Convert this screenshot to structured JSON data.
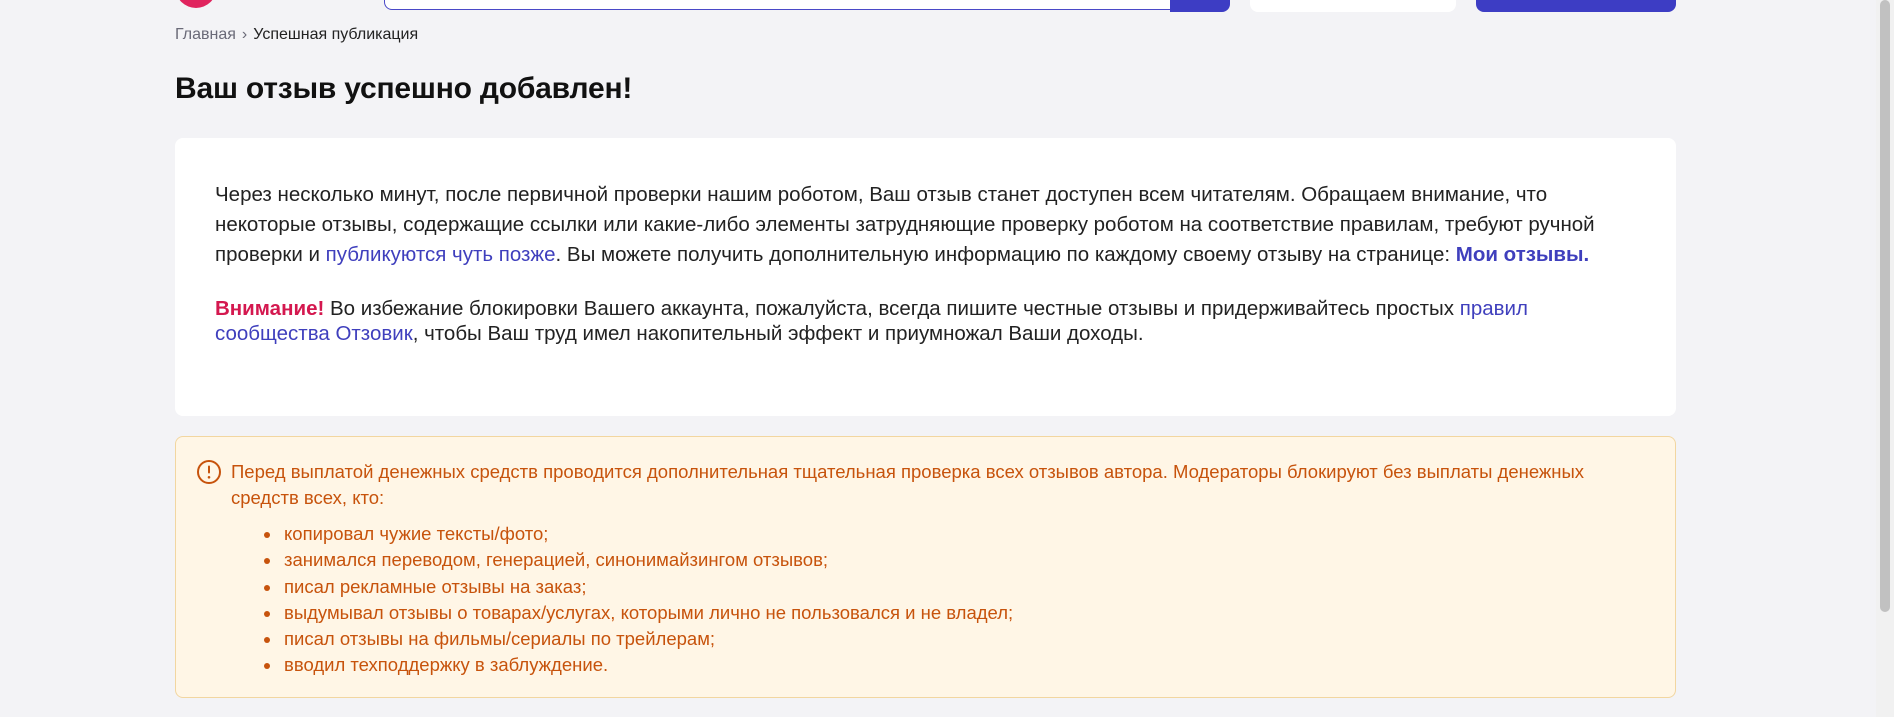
{
  "breadcrumb": {
    "home": "Главная",
    "separator": "›",
    "current": "Успешная публикация"
  },
  "page_title": "Ваш отзыв успешно добавлен!",
  "notice": {
    "p1_text_1": "Через несколько минут, после первичной проверки нашим роботом, Ваш отзыв станет доступен всем читателям. Обращаем внимание, что некоторые отзывы, содержащие ссылки или какие-либо элементы затрудняющие проверку роботом на соответствие правилам, требуют ручной проверки и ",
    "p1_link": "публикуются чуть позже",
    "p1_text_2": ". Вы можете получить дополнительную информацию по каждому своему отзыву на странице: ",
    "p1_my_reviews_link": "Мои отзывы",
    "p1_text_3": ".",
    "attention_label": "Внимание!",
    "p2_text_1": " Во избежание блокировки Вашего аккаунта, пожалуйста, всегда пишите честные отзывы и придерживайтесь простых ",
    "p2_rules_link": "правил сообщества Отзовик",
    "p2_text_2": ", чтобы Ваш труд имел накопительный эффект и приумножал Ваши доходы."
  },
  "warning": {
    "icon": "exclamation-circle-icon",
    "text": "Перед выплатой денежных средств проводится дополнительная тщательная проверка всех отзывов автора. Модераторы блокируют без выплаты денежных средств всех, кто:",
    "items": [
      "копировал чужие тексты/фото;",
      "занимался переводом, генерацией, синонимайзингом отзывов;",
      "писал рекламные отзывы на заказ;",
      "выдумывал отзывы о товарах/услугах, которыми лично не пользовался и не владел;",
      "писал отзывы на фильмы/сериалы по трейлерам;",
      "вводил техподдержку в заблуждение."
    ]
  },
  "colors": {
    "accent": "#3d3dc4",
    "brand_pink": "#e0245e",
    "attention": "#d4184f",
    "warning_text": "#c7530c",
    "warning_bg": "#fff6e6"
  }
}
